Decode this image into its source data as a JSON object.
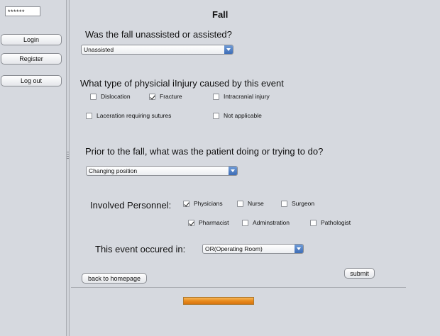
{
  "sidebar": {
    "password_mask": "******",
    "login_label": "Login",
    "register_label": "Register",
    "logout_label": "Log out"
  },
  "form": {
    "title": "Fall",
    "q1": {
      "question": "Was the fall unassisted or assisted?",
      "selected": "Unassisted"
    },
    "q2": {
      "question": "What type of physicial iInjury caused by this event",
      "options": [
        {
          "label": "Dislocation",
          "checked": false
        },
        {
          "label": "Fracture",
          "checked": true
        },
        {
          "label": "Intracranial injury",
          "checked": false
        },
        {
          "label": "Laceration requiring sutures",
          "checked": false
        },
        {
          "label": "Not applicable",
          "checked": false
        }
      ]
    },
    "q3": {
      "question": "Prior to the fall, what was the patient doing or trying to do?",
      "selected": "Changing position"
    },
    "personnel": {
      "label": "Involved Personnel:",
      "options": [
        {
          "label": "Physicians",
          "checked": true
        },
        {
          "label": "Nurse",
          "checked": false
        },
        {
          "label": "Surgeon",
          "checked": false
        },
        {
          "label": "Pharmacist",
          "checked": true
        },
        {
          "label": "Adminstration",
          "checked": false
        },
        {
          "label": "Pathologist",
          "checked": false
        }
      ]
    },
    "location": {
      "label": "This event occured in:",
      "selected": "OR(Operating Room)"
    },
    "back_label": "back to homepage",
    "submit_label": "submit",
    "progress_fraction": 1.0
  },
  "colors": {
    "background": "#d6d9df",
    "combo_arrow": "#3d6db6",
    "progress": "#e88a1a"
  }
}
